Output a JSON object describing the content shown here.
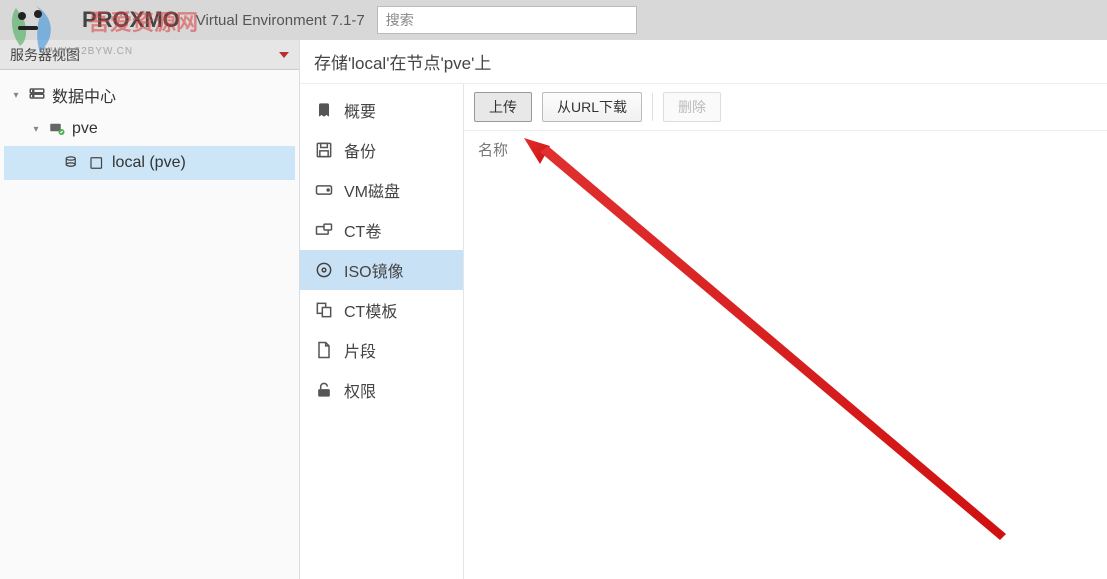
{
  "header": {
    "brand_text": "PROXMO",
    "watermark_overlay": "吾爱资源网",
    "watermark_url": "WWW.52BYW.CN",
    "version_label": "Virtual Environment 7.1-7",
    "search_placeholder": "搜索"
  },
  "left_panel": {
    "view_selector": "服务器视图",
    "tree": {
      "root": {
        "label": "数据中心"
      },
      "node": {
        "label": "pve"
      },
      "storage": {
        "label": "local (pve)"
      }
    }
  },
  "breadcrumb": "存储'local'在节点'pve'上",
  "inner_sidebar": {
    "items": [
      {
        "key": "summary",
        "label": "概要"
      },
      {
        "key": "backup",
        "label": "备份"
      },
      {
        "key": "vmdisk",
        "label": "VM磁盘"
      },
      {
        "key": "ctvol",
        "label": "CT卷"
      },
      {
        "key": "iso",
        "label": "ISO镜像"
      },
      {
        "key": "cttpl",
        "label": "CT模板"
      },
      {
        "key": "snippet",
        "label": "片段"
      },
      {
        "key": "perm",
        "label": "权限"
      }
    ]
  },
  "toolbar": {
    "upload_label": "上传",
    "download_url_label": "从URL下载",
    "delete_label": "删除"
  },
  "list": {
    "header_name": "名称"
  }
}
